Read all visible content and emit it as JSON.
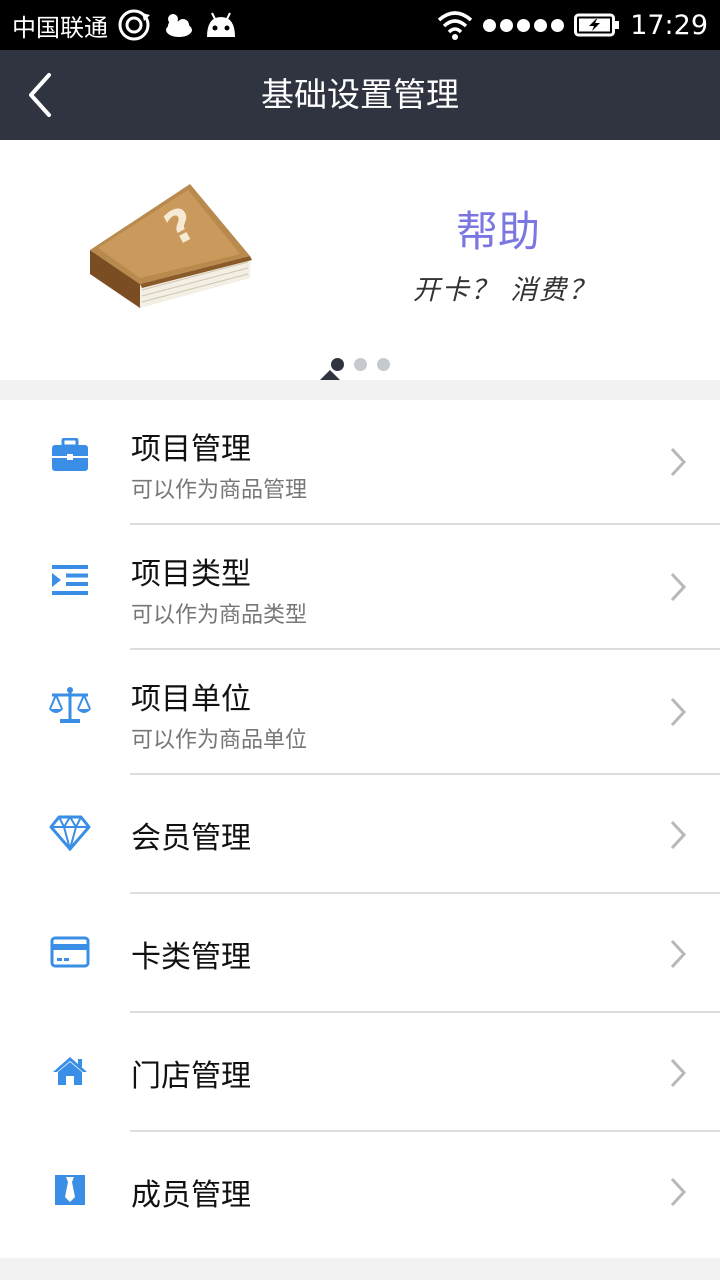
{
  "status_bar": {
    "carrier": "中国联通",
    "time": "17:29"
  },
  "header": {
    "title": "基础设置管理",
    "back_icon": "chevron-left-icon"
  },
  "banner": {
    "title": "帮助",
    "subtitle": "开卡？ 消费？",
    "page_count": 3,
    "active_page": 1,
    "title_color": "#7b77e0"
  },
  "menu": {
    "accent_color": "#3a8ee6",
    "items": [
      {
        "icon": "briefcase-icon",
        "title": "项目管理",
        "desc": "可以作为商品管理"
      },
      {
        "icon": "indent-list-icon",
        "title": "项目类型",
        "desc": "可以作为商品类型"
      },
      {
        "icon": "scale-icon",
        "title": "项目单位",
        "desc": "可以作为商品单位"
      },
      {
        "icon": "diamond-icon",
        "title": "会员管理"
      },
      {
        "icon": "credit-card-icon",
        "title": "卡类管理"
      },
      {
        "icon": "home-icon",
        "title": "门店管理"
      },
      {
        "icon": "id-badge-icon",
        "title": "成员管理"
      }
    ]
  },
  "colors": {
    "nav_background": "#2f3440",
    "page_background": "#f2f2f2"
  }
}
